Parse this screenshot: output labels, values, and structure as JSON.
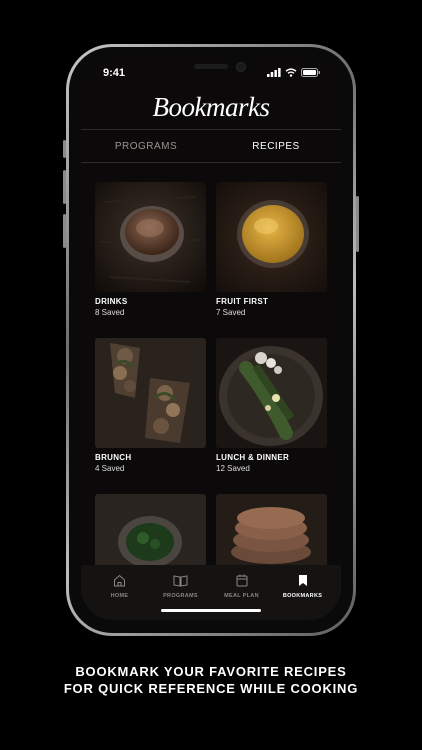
{
  "status": {
    "time": "9:41"
  },
  "header": {
    "title": "Bookmarks"
  },
  "tabs": [
    {
      "label": "PROGRAMS",
      "active": false
    },
    {
      "label": "RECIPES",
      "active": true
    }
  ],
  "recipes": [
    {
      "name": "DRINKS",
      "count": "8 Saved"
    },
    {
      "name": "FRUIT FIRST",
      "count": "7 Saved"
    },
    {
      "name": "BRUNCH",
      "count": "4 Saved"
    },
    {
      "name": "LUNCH & DINNER",
      "count": "12 Saved"
    },
    {
      "name": "",
      "count": ""
    },
    {
      "name": "",
      "count": ""
    }
  ],
  "nav": [
    {
      "label": "HOME",
      "icon": "home-icon",
      "active": false
    },
    {
      "label": "PROGRAMS",
      "icon": "book-icon",
      "active": false
    },
    {
      "label": "MEAL PLAN",
      "icon": "calendar-icon",
      "active": false
    },
    {
      "label": "BOOKMARKS",
      "icon": "bookmark-icon",
      "active": true
    }
  ],
  "caption": {
    "line1": "BOOKMARK YOUR FAVORITE RECIPES",
    "line2": "FOR QUICK REFERENCE WHILE COOKING"
  },
  "colors": {
    "background": "#000000",
    "screen": "#0b0909",
    "navbar": "#151212",
    "inactive_text": "#9a9590"
  }
}
